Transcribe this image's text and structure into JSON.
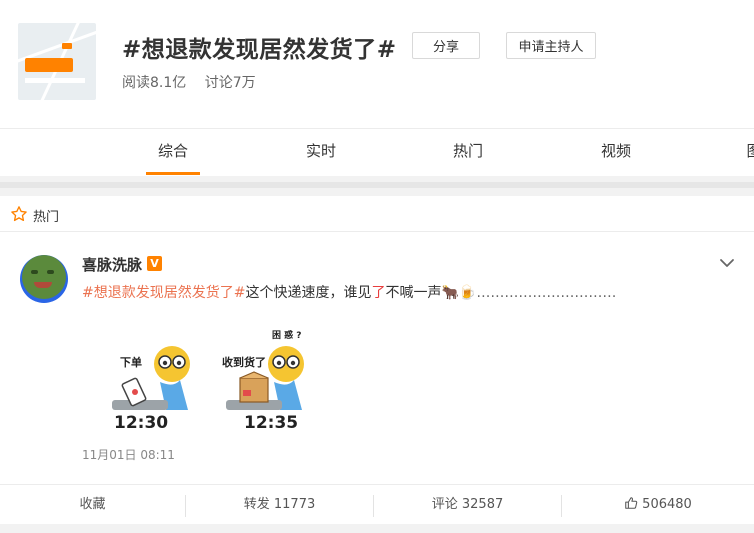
{
  "topic": {
    "title": "#想退款发现居然发货了#",
    "stats": {
      "reads": "阅读8.1亿",
      "discussions": "讨论7万"
    },
    "share_button": "分享",
    "host_button": "申请主持人",
    "thumbnail_icon": "map-thumbnail"
  },
  "tabs": [
    {
      "label": "综合",
      "active": true
    },
    {
      "label": "实时"
    },
    {
      "label": "热门"
    },
    {
      "label": "视频"
    },
    {
      "label": "图"
    }
  ],
  "section": {
    "label": "热门",
    "icon": "star-icon"
  },
  "post": {
    "username": "喜脉洗脉",
    "verified_badge": "V",
    "text": {
      "hashtag": "#想退款发现居然发货了#",
      "middle": "这个快递速度，谁见",
      "red": "了",
      "tail": "不喊一声🐂🍺",
      "dots": "…………………………"
    },
    "images": [
      {
        "caption": "下单",
        "time": "12:30"
      },
      {
        "caption": "收到货了",
        "time": "12:35",
        "extra": "困 惑 ?"
      }
    ],
    "timestamp": "11月01日 08:11"
  },
  "actions": {
    "favorite": "收藏",
    "repost": "转发 11773",
    "comment": "评论 32587",
    "like": "506480"
  },
  "colors": {
    "accent": "#ff8200",
    "hashtag": "#eb7350",
    "text": "#333333"
  }
}
